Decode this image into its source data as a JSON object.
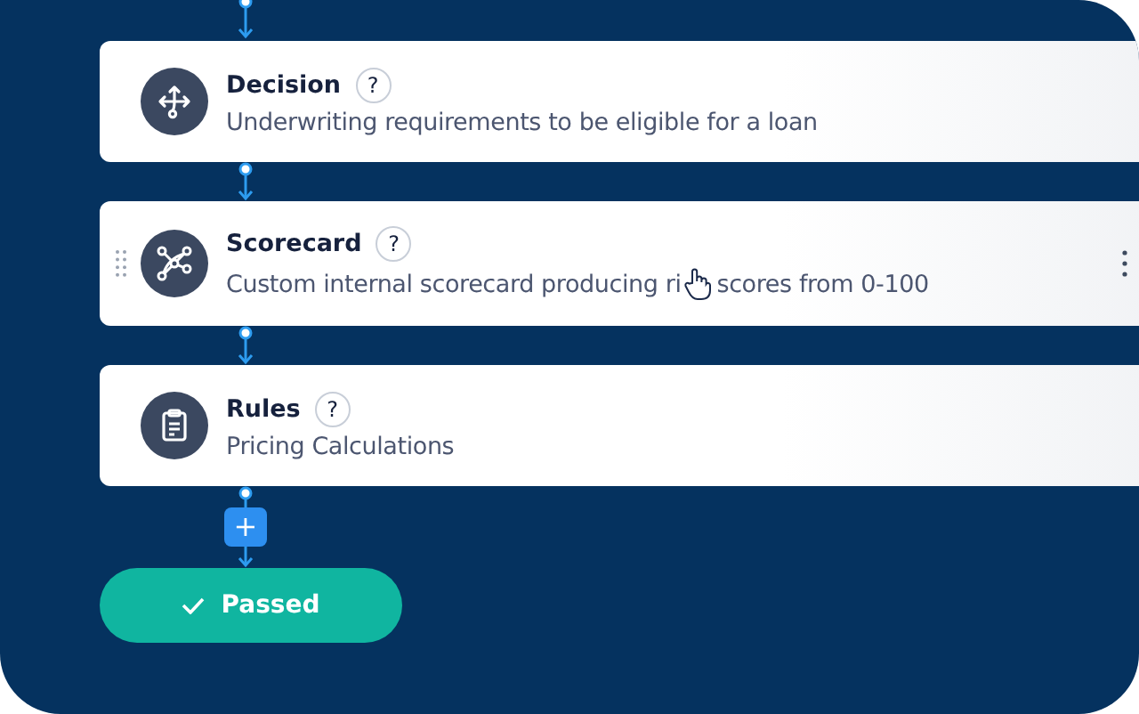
{
  "steps": [
    {
      "kind": "decision",
      "title": "Decision",
      "help": "?",
      "description": "Underwriting requirements to be eligible for a loan",
      "hovered": false
    },
    {
      "kind": "scorecard",
      "title": "Scorecard",
      "help": "?",
      "description": "Custom internal scorecard producing ri",
      "description_after": "scores from 0-100",
      "hovered": true
    },
    {
      "kind": "rules",
      "title": "Rules",
      "help": "?",
      "description": "Pricing Calculations",
      "hovered": false
    }
  ],
  "add_button": {
    "label": "+"
  },
  "result": {
    "label": "Passed"
  }
}
